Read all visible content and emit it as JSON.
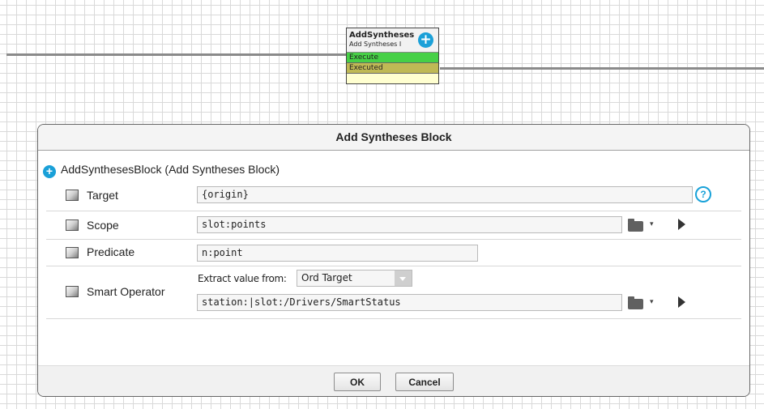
{
  "node": {
    "title": "AddSyntheses",
    "subtitle": "Add Syntheses I",
    "slots": [
      "Execute",
      "Executed"
    ]
  },
  "dialog": {
    "title": "Add Syntheses Block",
    "object": "AddSynthesesBlock  (Add Syntheses Block)",
    "rows": {
      "target": {
        "label": "Target",
        "value": "{origin}"
      },
      "scope": {
        "label": "Scope",
        "value": "slot:points"
      },
      "predicate": {
        "label": "Predicate",
        "value": "n:point"
      },
      "smart_operator": {
        "label": "Smart Operator",
        "extract_label": "Extract value from:",
        "extract_selected": "Ord Target",
        "value": "station:|slot:/Drivers/SmartStatus"
      }
    },
    "buttons": {
      "ok": "OK",
      "cancel": "Cancel"
    }
  },
  "icons": {
    "add": "add-circle-icon",
    "help": "help-icon",
    "folder": "folder-icon",
    "dropdown": "chevron-down-icon",
    "arrow": "play-arrow-icon",
    "slot": "slot-cube-icon"
  },
  "colors": {
    "accent": "#1aa0d8",
    "execute_slot": "#46d046",
    "executed_slot": "#bfb955",
    "node_body": "#ffffd0"
  }
}
